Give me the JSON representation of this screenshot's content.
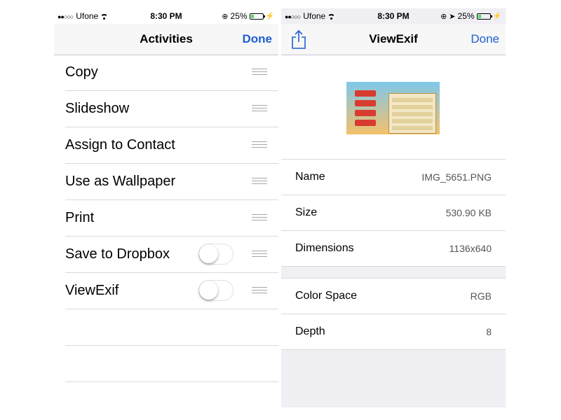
{
  "left": {
    "status": {
      "carrier": "Ufone",
      "time": "8:30 PM",
      "battery": "25%",
      "battery_level": 0.25
    },
    "nav": {
      "title": "Activities",
      "done": "Done"
    },
    "items": [
      {
        "label": "Copy"
      },
      {
        "label": "Slideshow"
      },
      {
        "label": "Assign to Contact"
      },
      {
        "label": "Use as Wallpaper"
      },
      {
        "label": "Print"
      },
      {
        "label": "Save to Dropbox",
        "toggle": false
      },
      {
        "label": "ViewExif",
        "toggle": false
      }
    ]
  },
  "right": {
    "status": {
      "carrier": "Ufone",
      "time": "8:30 PM",
      "battery": "25%",
      "battery_level": 0.25
    },
    "nav": {
      "title": "ViewExif",
      "done": "Done"
    },
    "info": [
      {
        "key": "Name",
        "value": "IMG_5651.PNG"
      },
      {
        "key": "Size",
        "value": "530.90 KB"
      },
      {
        "key": "Dimensions",
        "value": "1136x640"
      }
    ],
    "info2": [
      {
        "key": "Color Space",
        "value": "RGB"
      },
      {
        "key": "Depth",
        "value": "8"
      }
    ]
  },
  "colors": {
    "accent": "#1f5fd1",
    "battery": "#4cd964",
    "grouped_bg": "#efeff4"
  }
}
